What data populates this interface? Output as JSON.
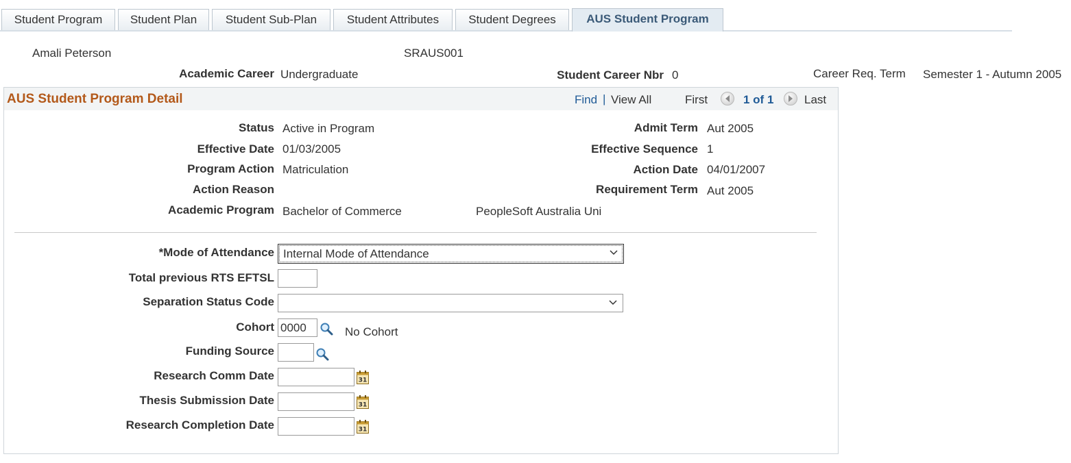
{
  "tabs": [
    {
      "label": "Student Program"
    },
    {
      "label": "Student Plan"
    },
    {
      "label": "Student Sub-Plan"
    },
    {
      "label": "Student Attributes"
    },
    {
      "label": "Student Degrees"
    },
    {
      "label": "AUS Student Program"
    }
  ],
  "active_tab": "AUS Student Program",
  "header": {
    "student_name": "Amali Peterson",
    "student_id": "SRAUS001",
    "academic_career_label": "Academic Career",
    "academic_career_value": "Undergraduate",
    "career_nbr_label": "Student Career Nbr",
    "career_nbr_value": "0",
    "career_req_term_label": "Career Req. Term",
    "career_req_term_value": "Semester 1 - Autumn 2005"
  },
  "detail": {
    "title": "AUS Student Program Detail",
    "find_label": "Find",
    "separator": "|",
    "view_all_label": "View All",
    "first_label": "First",
    "page_indicator": "1 of 1",
    "last_label": "Last",
    "left_fields": [
      {
        "label": "Status",
        "value": "Active in Program"
      },
      {
        "label": "Effective Date",
        "value": "01/03/2005"
      },
      {
        "label": "Program Action",
        "value": "Matriculation"
      },
      {
        "label": "Action Reason",
        "value": ""
      },
      {
        "label": "Academic Program",
        "value": "Bachelor of Commerce"
      }
    ],
    "institution": "PeopleSoft Australia Uni",
    "right_fields": [
      {
        "label": "Admit Term",
        "value": "Aut 2005"
      },
      {
        "label": "Effective Sequence",
        "value": "1"
      },
      {
        "label": "Action Date",
        "value": "04/01/2007"
      },
      {
        "label": "Requirement Term",
        "value": "Aut 2005"
      }
    ]
  },
  "form": {
    "mode_of_attendance": {
      "label": "*Mode of Attendance",
      "value": "Internal Mode of Attendance"
    },
    "total_previous_rts_eftsl": {
      "label": "Total previous RTS EFTSL",
      "value": ""
    },
    "separation_status_code": {
      "label": "Separation Status Code",
      "value": ""
    },
    "cohort": {
      "label": "Cohort",
      "value": "0000",
      "description": "No Cohort"
    },
    "funding_source": {
      "label": "Funding Source",
      "value": ""
    },
    "research_comm_date": {
      "label": "Research Comm Date",
      "value": ""
    },
    "thesis_submission_date": {
      "label": "Thesis Submission Date",
      "value": ""
    },
    "research_completion_date": {
      "label": "Research Completion Date",
      "value": ""
    }
  },
  "icons": {
    "lookup": "magnifier-icon",
    "calendar": "calendar-icon",
    "calendar_glyph_text": "31",
    "dropdown": "chevron-down-icon",
    "prev": "previous-arrow-icon",
    "next": "next-arrow-icon"
  },
  "colors": {
    "title": "#b3591a",
    "link": "#1f5a96",
    "active_tab_text": "#3b5a78"
  }
}
